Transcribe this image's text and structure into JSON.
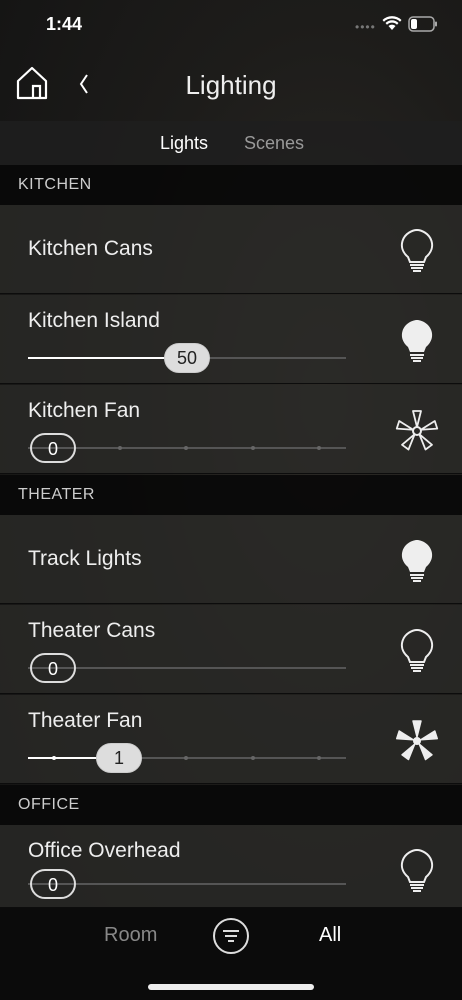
{
  "status": {
    "time": "1:44",
    "dots": "••••"
  },
  "header": {
    "title": "Lighting"
  },
  "tabs": {
    "lights": "Lights",
    "scenes": "Scenes"
  },
  "sections": {
    "kitchen": "KITCHEN",
    "theater": "THEATER",
    "office": "OFFICE"
  },
  "devices": {
    "kitchen_cans": {
      "name": "Kitchen Cans",
      "icon": "bulb-off-icon"
    },
    "kitchen_island": {
      "name": "Kitchen Island",
      "value": "50",
      "level_percent": 50,
      "icon": "bulb-on-icon"
    },
    "kitchen_fan": {
      "name": "Kitchen Fan",
      "value": "0",
      "speed_step": 0,
      "speed_steps": 5,
      "icon": "fan-off-icon"
    },
    "track_lights": {
      "name": "Track Lights",
      "icon": "bulb-on-icon"
    },
    "theater_cans": {
      "name": "Theater Cans",
      "value": "0",
      "level_percent": 0,
      "icon": "bulb-off-icon"
    },
    "theater_fan": {
      "name": "Theater Fan",
      "value": "1",
      "speed_step": 1,
      "speed_steps": 5,
      "icon": "fan-on-icon"
    },
    "office_overhead": {
      "name": "Office Overhead",
      "value": "0",
      "level_percent": 0,
      "icon": "bulb-off-icon"
    }
  },
  "bottom": {
    "room": "Room",
    "all": "All"
  },
  "colors": {
    "accent": "#dddddd",
    "background": "#1d1c1a",
    "section": "#080808"
  }
}
